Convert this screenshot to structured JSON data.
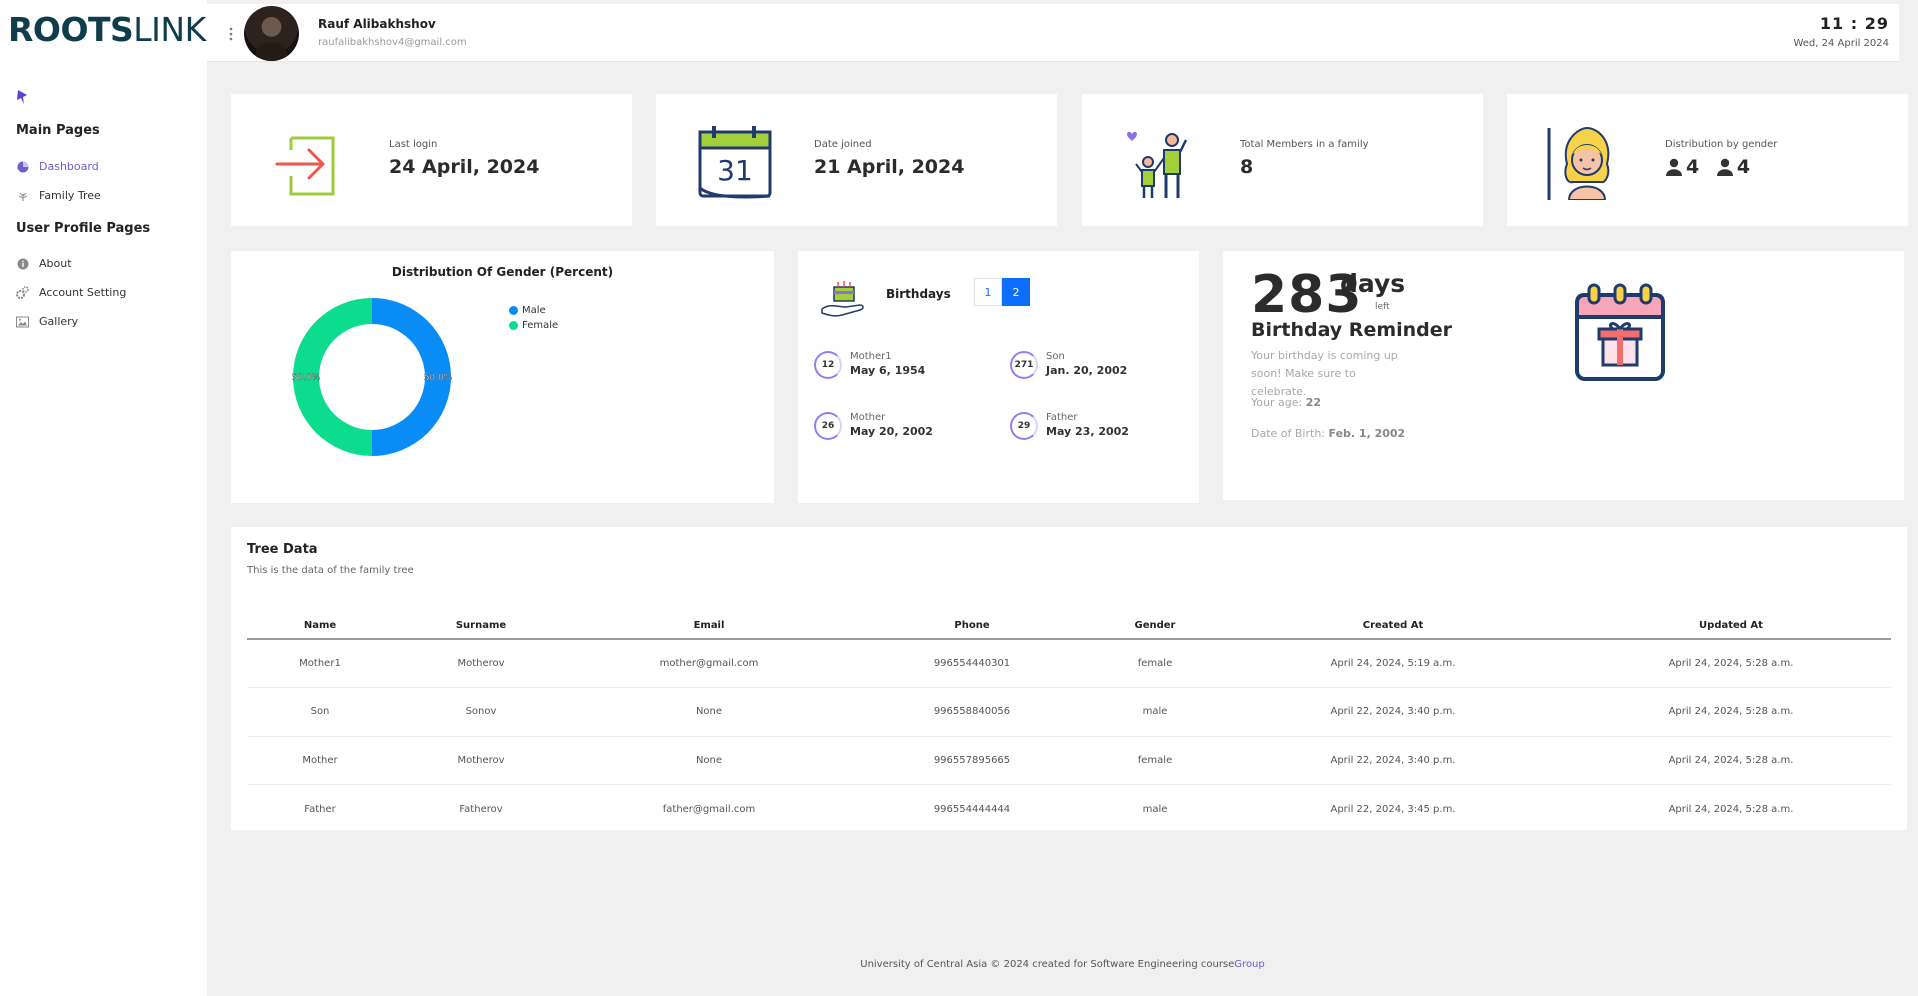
{
  "brand": {
    "bold": "ROOTS",
    "light": "LINK"
  },
  "sidebar": {
    "main_title": "Main Pages",
    "main_items": [
      {
        "label": "Dashboard",
        "icon": "pie-chart-icon",
        "active": true
      },
      {
        "label": "Family Tree",
        "icon": "tree-icon",
        "active": false
      }
    ],
    "profile_title": "User Profile Pages",
    "profile_items": [
      {
        "label": "About",
        "icon": "info-icon"
      },
      {
        "label": "Account Setting",
        "icon": "gears-icon"
      },
      {
        "label": "Gallery",
        "icon": "image-icon"
      }
    ]
  },
  "header": {
    "user_name": "Rauf Alibakhshov",
    "user_email": "raufalibakhshov4@gmail.com",
    "time": "11 : 29",
    "date": "Wed, 24 April 2024"
  },
  "stats": [
    {
      "label": "Last login",
      "value": "24 April, 2024",
      "icon": "login-arrow-icon"
    },
    {
      "label": "Date joined",
      "value": "21 April, 2024",
      "icon": "calendar-icon",
      "icon_text": "31"
    },
    {
      "label": "Total Members in a family",
      "value": "8",
      "icon": "family-icon"
    },
    {
      "label": "Distribution by gender",
      "male_count": "4",
      "female_count": "4",
      "icon": "woman-avatar-icon"
    }
  ],
  "chart_data": {
    "type": "pie",
    "title": "Distribution Of Gender (Percent)",
    "categories": [
      "Male",
      "Female"
    ],
    "values": [
      50.0,
      50.0
    ],
    "labels": [
      "50.0%",
      "50.0%"
    ],
    "colors": [
      "#0a8cf7",
      "#0bdc8e"
    ],
    "donut": true,
    "legend_position": "top-right"
  },
  "birthdays": {
    "title": "Birthdays",
    "pages": [
      "1",
      "2"
    ],
    "active_page": "2",
    "items": [
      {
        "days": "12",
        "relation": "Mother1",
        "date": "May 6, 1954"
      },
      {
        "days": "271",
        "relation": "Son",
        "date": "Jan. 20, 2002"
      },
      {
        "days": "26",
        "relation": "Mother",
        "date": "May 20, 2002"
      },
      {
        "days": "29",
        "relation": "Father",
        "date": "May 23, 2002"
      }
    ]
  },
  "reminder": {
    "days": "283",
    "days_word": "days",
    "left_word": "left",
    "title": "Birthday Reminder",
    "text": "Your birthday is coming up soon! Make sure to celebrate.",
    "age_label": "Your age:",
    "age": "22",
    "dob_label": "Date of Birth:",
    "dob": "Feb. 1, 2002"
  },
  "tree": {
    "title": "Tree Data",
    "subtitle": "This is the data of the family tree",
    "columns": [
      "Name",
      "Surname",
      "Email",
      "Phone",
      "Gender",
      "Created At",
      "Updated At"
    ],
    "rows": [
      [
        "Mother1",
        "Motherov",
        "mother@gmail.com",
        "996554440301",
        "female",
        "April 24, 2024, 5:19 a.m.",
        "April 24, 2024, 5:28 a.m."
      ],
      [
        "Son",
        "Sonov",
        "None",
        "996558840056",
        "male",
        "April 22, 2024, 3:40 p.m.",
        "April 24, 2024, 5:28 a.m."
      ],
      [
        "Mother",
        "Motherov",
        "None",
        "996557895665",
        "female",
        "April 22, 2024, 3:40 p.m.",
        "April 24, 2024, 5:28 a.m."
      ],
      [
        "Father",
        "Fatherov",
        "father@gmail.com",
        "996554444444",
        "male",
        "April 22, 2024, 3:45 p.m.",
        "April 24, 2024, 5:28 a.m."
      ]
    ]
  },
  "footer": {
    "text": "University of Central Asia © 2024 created for Software Engineering course",
    "link": "Group"
  }
}
